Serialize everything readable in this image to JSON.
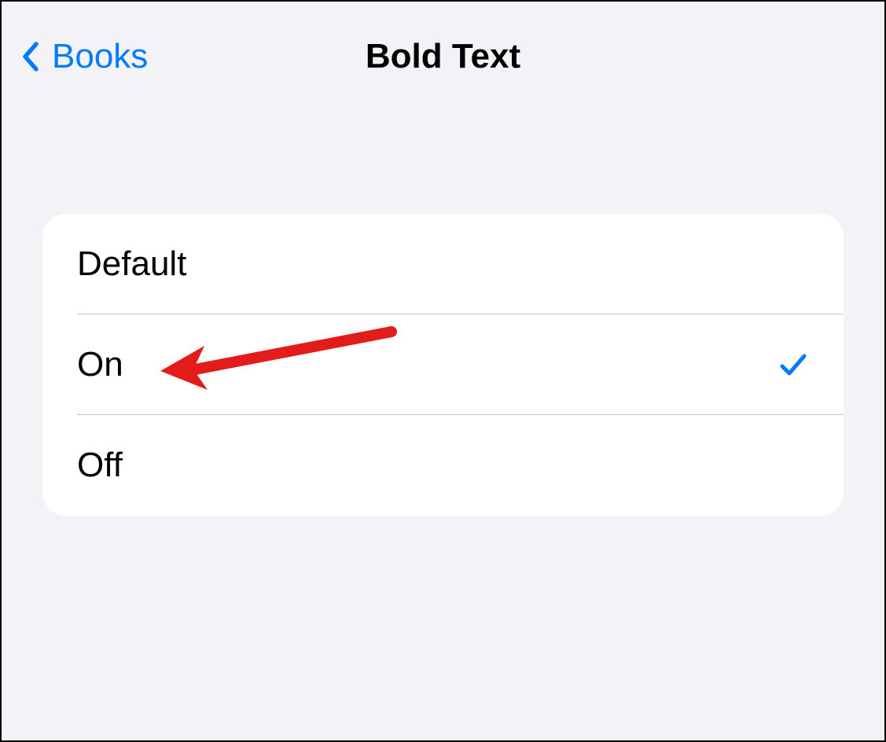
{
  "nav": {
    "back_label": "Books",
    "title": "Bold Text"
  },
  "options": {
    "items": [
      {
        "label": "Default",
        "selected": false
      },
      {
        "label": "On",
        "selected": true
      },
      {
        "label": "Off",
        "selected": false
      }
    ]
  },
  "colors": {
    "accent": "#007aff",
    "background": "#f2f2f7",
    "annotation": "#e21b1b"
  }
}
